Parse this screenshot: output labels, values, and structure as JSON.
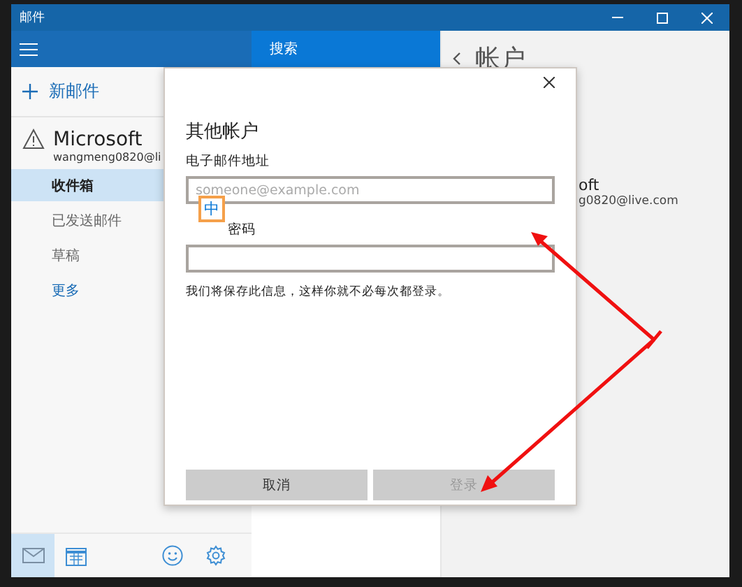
{
  "window": {
    "title": "邮件"
  },
  "sidebar": {
    "new_mail": "新邮件",
    "account": {
      "name": "Microsoft",
      "email": "wangmeng0820@li"
    },
    "folders": [
      {
        "label": "收件箱",
        "selected": true
      },
      {
        "label": "已发送邮件",
        "selected": false
      },
      {
        "label": "草稿",
        "selected": false
      }
    ],
    "more": "更多",
    "bottom_bar": [
      {
        "kind": "mail",
        "selected": true
      },
      {
        "kind": "calendar",
        "selected": false
      },
      {
        "kind": "feedback",
        "selected": false
      },
      {
        "kind": "settings",
        "selected": false
      }
    ]
  },
  "search": {
    "label": "搜索"
  },
  "accounts_panel": {
    "title": "帐户",
    "account_name": "oft",
    "account_email": "g0820@live.com"
  },
  "dialog": {
    "title": "其他帐户",
    "email_label": "电子邮件地址",
    "email_placeholder": "someone@example.com",
    "ime_indicator": "中",
    "password_label": "密码",
    "note": "我们将保存此信息，这样你就不必每次都登录。",
    "buttons": [
      {
        "label": "取消",
        "disabled": false
      },
      {
        "label": "登录",
        "disabled": true
      }
    ]
  }
}
